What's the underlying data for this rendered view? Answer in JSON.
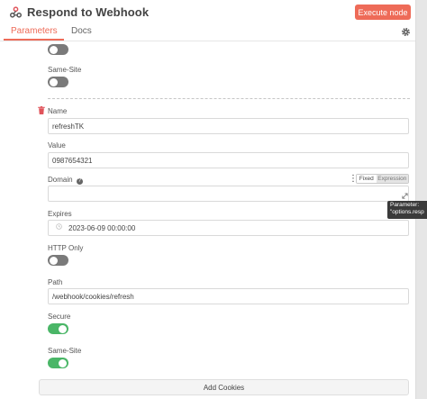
{
  "header": {
    "title": "Respond to Webhook",
    "execute_label": "Execute node"
  },
  "tabs": [
    {
      "label": "Parameters"
    },
    {
      "label": "Docs"
    }
  ],
  "top_section": {
    "same_site_label": "Same-Site",
    "toggle_top_on": false,
    "same_site_on": false
  },
  "cookie": {
    "name_label": "Name",
    "name_value": "refreshTK",
    "value_label": "Value",
    "value_value": "0987654321",
    "domain_label": "Domain",
    "domain_value": "",
    "fixed_label": "Fixed",
    "expression_label": "Expression",
    "expires_label": "Expires",
    "expires_value": "2023-06-09 00:00:00",
    "http_only_label": "HTTP Only",
    "http_only_on": false,
    "path_label": "Path",
    "path_value": "/webhook/cookies/refresh",
    "secure_label": "Secure",
    "secure_on": true,
    "same_site_label": "Same-Site",
    "same_site_on": true
  },
  "tooltip": {
    "line1": "Parameter:",
    "line2": "\"options.resp"
  },
  "add_cookies_label": "Add Cookies",
  "colors": {
    "accent": "#ee6b58",
    "toggle_on": "#4ab667",
    "toggle_off": "#7a7a7a"
  }
}
